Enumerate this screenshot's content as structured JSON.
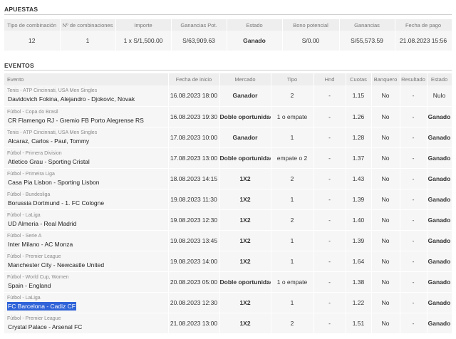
{
  "apuestas": {
    "title": "APUESTAS",
    "headers": [
      "Tipo de combinación",
      "Nº de combinaciones",
      "Importe",
      "Ganancias Pot.",
      "Estado",
      "Bono potencial",
      "Ganancias",
      "Fecha de pago"
    ],
    "row": {
      "tipo": "12",
      "num": "1",
      "importe": "1 x S/1,500.00",
      "ganancias_pot": "S/63,909.63",
      "estado": "Ganado",
      "bono": "S/0.00",
      "ganancias": "S/55,573.59",
      "fecha_pago": "21.08.2023 15:56"
    }
  },
  "eventos": {
    "title": "EVENTOS",
    "headers": [
      "Evento",
      "Fecha de inicio",
      "Mercado",
      "Tipo",
      "Hnd",
      "Cuotas",
      "Banquero",
      "Resultado",
      "Estado"
    ],
    "rows": [
      {
        "league": "Tenis - ATP Cincinnati, USA Men Singles",
        "name": "Davidovich Fokina, Alejandro - Djokovic, Novak",
        "date": "16.08.2023 18:00",
        "market": "Ganador",
        "tipo": "2",
        "hnd": "-",
        "cuota": "1.15",
        "banquero": "No",
        "resultado": "-",
        "estado": "Nulo"
      },
      {
        "league": "Fútbol - Copa do Brasil",
        "name": "CR Flamengo RJ - Gremio FB Porto Alegrense RS",
        "date": "16.08.2023 19:30",
        "market": "Doble oportunidad",
        "tipo": "1 o empate",
        "hnd": "-",
        "cuota": "1.26",
        "banquero": "No",
        "resultado": "-",
        "estado": "Ganado"
      },
      {
        "league": "Tenis - ATP Cincinnati, USA Men Singles",
        "name": "Alcaraz, Carlos - Paul, Tommy",
        "date": "17.08.2023 10:00",
        "market": "Ganador",
        "tipo": "1",
        "hnd": "-",
        "cuota": "1.28",
        "banquero": "No",
        "resultado": "-",
        "estado": "Ganado"
      },
      {
        "league": "Fútbol - Primera Division",
        "name": "Atletico Grau - Sporting Cristal",
        "date": "17.08.2023 13:00",
        "market": "Doble oportunidad",
        "tipo": "empate o 2",
        "hnd": "-",
        "cuota": "1.37",
        "banquero": "No",
        "resultado": "-",
        "estado": "Ganado"
      },
      {
        "league": "Fútbol - Primeira Liga",
        "name": "Casa Pia Lisbon - Sporting Lisbon",
        "date": "18.08.2023 14:15",
        "market": "1X2",
        "tipo": "2",
        "hnd": "-",
        "cuota": "1.43",
        "banquero": "No",
        "resultado": "-",
        "estado": "Ganado"
      },
      {
        "league": "Fútbol - Bundesliga",
        "name": "Borussia Dortmund - 1. FC Cologne",
        "date": "19.08.2023 11:30",
        "market": "1X2",
        "tipo": "1",
        "hnd": "-",
        "cuota": "1.39",
        "banquero": "No",
        "resultado": "-",
        "estado": "Ganado"
      },
      {
        "league": "Fútbol - LaLiga",
        "name": "UD Almeria - Real Madrid",
        "date": "19.08.2023 12:30",
        "market": "1X2",
        "tipo": "2",
        "hnd": "-",
        "cuota": "1.40",
        "banquero": "No",
        "resultado": "-",
        "estado": "Ganado"
      },
      {
        "league": "Fútbol - Serie A",
        "name": "Inter Milano - AC Monza",
        "date": "19.08.2023 13:45",
        "market": "1X2",
        "tipo": "1",
        "hnd": "-",
        "cuota": "1.39",
        "banquero": "No",
        "resultado": "-",
        "estado": "Ganado"
      },
      {
        "league": "Fútbol - Premier League",
        "name": "Manchester City - Newcastle United",
        "date": "19.08.2023 14:00",
        "market": "1X2",
        "tipo": "1",
        "hnd": "-",
        "cuota": "1.64",
        "banquero": "No",
        "resultado": "-",
        "estado": "Ganado"
      },
      {
        "league": "Fútbol - World Cup, Women",
        "name": "Spain - England",
        "date": "20.08.2023 05:00",
        "market": "Doble oportunidad",
        "tipo": "1 o empate",
        "hnd": "-",
        "cuota": "1.38",
        "banquero": "No",
        "resultado": "-",
        "estado": "Ganado"
      },
      {
        "league": "Fútbol - LaLiga",
        "name": "FC Barcelona - Cadiz CF",
        "date": "20.08.2023 12:30",
        "market": "1X2",
        "tipo": "1",
        "hnd": "-",
        "cuota": "1.22",
        "banquero": "No",
        "resultado": "-",
        "estado": "Ganado"
      },
      {
        "league": "Fútbol - Premier League",
        "name": "Crystal Palace - Arsenal FC",
        "date": "21.08.2023 13:00",
        "market": "1X2",
        "tipo": "2",
        "hnd": "-",
        "cuota": "1.51",
        "banquero": "No",
        "resultado": "-",
        "estado": "Ganado"
      }
    ]
  },
  "colors": {
    "market": "#e8650e",
    "won": "#3fae3f",
    "selection": "#2f63d8"
  }
}
